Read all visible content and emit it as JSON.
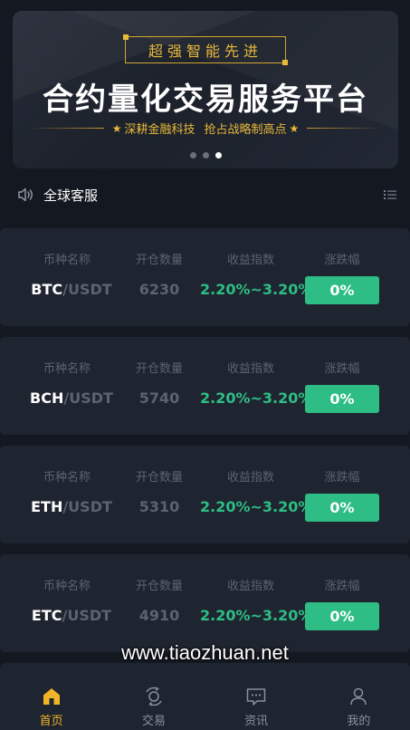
{
  "banner": {
    "tag": "超强智能先进",
    "title": "合约量化交易服务平台",
    "subtitle_left": "深耕金融科技",
    "subtitle_right": "抢占战略制高点",
    "slides": 3,
    "active_slide": 3
  },
  "notice": {
    "text": "全球客服"
  },
  "columns": {
    "name": "币种名称",
    "qty": "开仓数量",
    "yield": "收益指数",
    "change": "涨跌幅"
  },
  "rows": [
    {
      "base": "BTC",
      "quote": "/USDT",
      "qty": "6230",
      "yield": "2.20%~3.20%",
      "change": "0%"
    },
    {
      "base": "BCH",
      "quote": "/USDT",
      "qty": "5740",
      "yield": "2.20%~3.20%",
      "change": "0%"
    },
    {
      "base": "ETH",
      "quote": "/USDT",
      "qty": "5310",
      "yield": "2.20%~3.20%",
      "change": "0%"
    },
    {
      "base": "ETC",
      "quote": "/USDT",
      "qty": "4910",
      "yield": "2.20%~3.20%",
      "change": "0%"
    }
  ],
  "watermark": "www.tiaozhuan.net",
  "tabs": [
    {
      "label": "首页",
      "icon": "home-icon",
      "active": true
    },
    {
      "label": "交易",
      "icon": "exchange-icon",
      "active": false
    },
    {
      "label": "资讯",
      "icon": "message-icon",
      "active": false
    },
    {
      "label": "我的",
      "icon": "user-icon",
      "active": false
    }
  ],
  "colors": {
    "background": "#141821",
    "card": "#1f2530",
    "accent_gold": "#f0b429",
    "positive_green": "#2dbd85",
    "muted_text": "#5c6370"
  }
}
